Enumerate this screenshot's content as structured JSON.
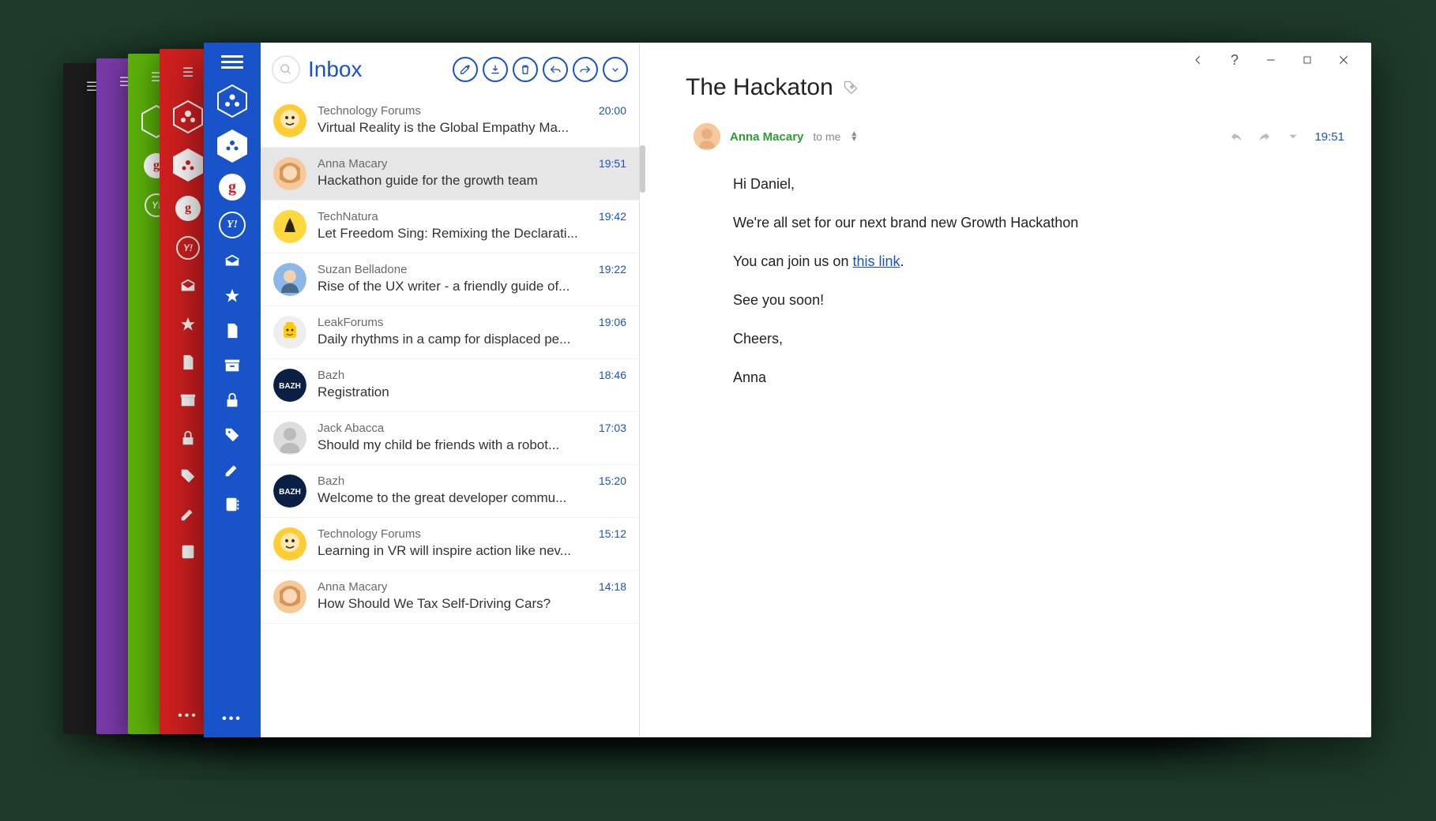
{
  "stackColors": [
    "#1c1c1c",
    "#7a3aa8",
    "#5bb00a",
    "#d21f1f"
  ],
  "sidebar": {
    "accounts": [
      {
        "type": "hex-outline",
        "name": "team-account"
      },
      {
        "type": "hex-filled",
        "name": "team-account-active"
      },
      {
        "type": "google",
        "label": "g",
        "name": "google-account"
      },
      {
        "type": "yahoo",
        "label": "Y!",
        "name": "yahoo-account"
      }
    ],
    "navIcons": [
      "inbox",
      "star",
      "file",
      "archive",
      "lock",
      "tag",
      "edit",
      "contacts"
    ],
    "moreLabel": "•••"
  },
  "list": {
    "folderTitle": "Inbox",
    "tools": [
      "compose",
      "download",
      "delete",
      "reply",
      "forward",
      "more"
    ],
    "messages": [
      {
        "sender": "Technology Forums",
        "subject": "Virtual Reality is the Global Empathy Ma...",
        "time": "20:00",
        "avatar": "cartoon-yellow",
        "selected": false
      },
      {
        "sender": "Anna Macary",
        "subject": "Hackathon guide for the growth team",
        "time": "19:51",
        "avatar": "anna",
        "selected": true
      },
      {
        "sender": "TechNatura",
        "subject": "Let Freedom Sing: Remixing the Declarati...",
        "time": "19:42",
        "avatar": "deer-yellow",
        "selected": false
      },
      {
        "sender": "Suzan Belladone",
        "subject": "Rise of the UX writer - a friendly guide of...",
        "time": "19:22",
        "avatar": "suzan",
        "selected": false
      },
      {
        "sender": "LeakForums",
        "subject": "Daily rhythms in a camp for displaced pe...",
        "time": "19:06",
        "avatar": "lego",
        "selected": false
      },
      {
        "sender": "Bazh",
        "subject": "Registration",
        "time": "18:46",
        "avatar": "bazh",
        "selected": false
      },
      {
        "sender": "Jack Abacca",
        "subject": "Should my child be friends with a robot...",
        "time": "17:03",
        "avatar": "jack",
        "selected": false
      },
      {
        "sender": "Bazh",
        "subject": "Welcome to the great developer commu...",
        "time": "15:20",
        "avatar": "bazh",
        "selected": false
      },
      {
        "sender": "Technology Forums",
        "subject": "Learning in VR will inspire action like nev...",
        "time": "15:12",
        "avatar": "cartoon-yellow",
        "selected": false
      },
      {
        "sender": "Anna Macary",
        "subject": "How Should We Tax Self-Driving Cars?",
        "time": "14:18",
        "avatar": "anna",
        "selected": false
      }
    ]
  },
  "detail": {
    "subject": "The Hackaton",
    "senderName": "Anna Macary",
    "toLabel": "to me",
    "time": "19:51",
    "body": {
      "greeting": "Hi Daniel,",
      "line1": "We're all set for our next brand new Growth Hackathon",
      "line2_pre": "You can join us on ",
      "line2_link": "this link",
      "line2_post": ".",
      "line3": "See you soon!",
      "signoff": "Cheers,",
      "name": "Anna"
    }
  },
  "titlebar": {
    "buttons": [
      "back",
      "help",
      "minimize",
      "maximize",
      "close"
    ]
  }
}
